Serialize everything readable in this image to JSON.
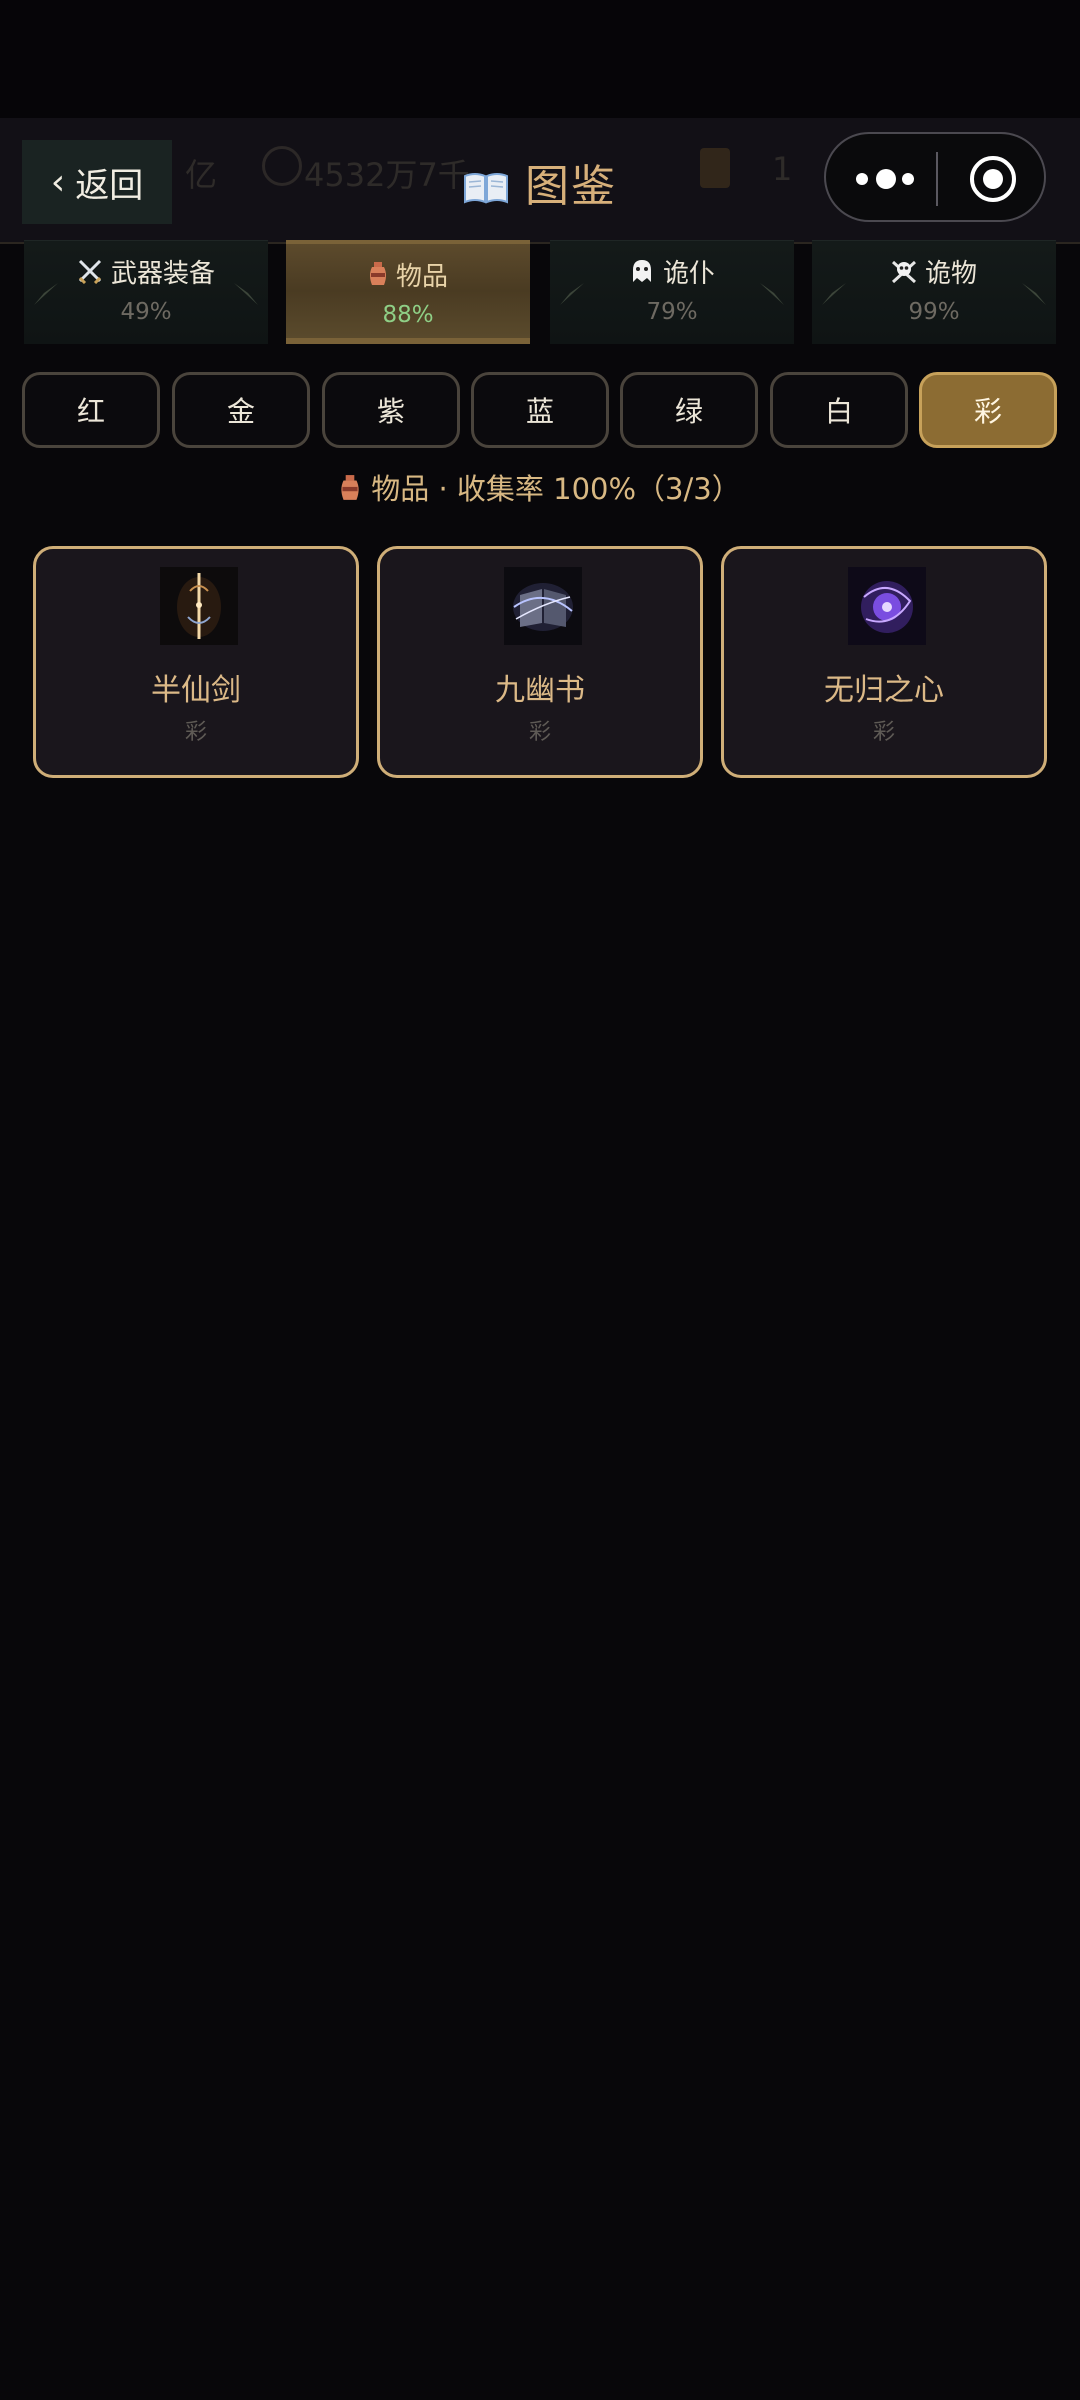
{
  "header": {
    "back_label": "返回",
    "title": "图鉴",
    "ghost_left": "亿",
    "ghost_gold": "4532万7千",
    "ghost_right": "1"
  },
  "categories": [
    {
      "label": "武器装备",
      "percent": "49%",
      "icon": "crossed-swords-icon"
    },
    {
      "label": "物品",
      "percent": "88%",
      "icon": "vase-icon",
      "active": true
    },
    {
      "label": "诡仆",
      "percent": "79%",
      "icon": "ghost-icon"
    },
    {
      "label": "诡物",
      "percent": "99%",
      "icon": "skull-crossbones-icon"
    }
  ],
  "grades": [
    "红",
    "金",
    "紫",
    "蓝",
    "绿",
    "白",
    "彩"
  ],
  "active_grade": "彩",
  "summary": {
    "category": "物品",
    "separator": "·",
    "text": "收集率 100%（3/3）"
  },
  "items": [
    {
      "name": "半仙剑",
      "grade": "彩",
      "icon": "sword-icon"
    },
    {
      "name": "九幽书",
      "grade": "彩",
      "icon": "book-icon"
    },
    {
      "name": "无归之心",
      "grade": "彩",
      "icon": "heart-orb-icon"
    }
  ],
  "colors": {
    "background": "#08070a",
    "accent_gold": "#cfae78",
    "active_filter": "#8c6c33",
    "percent_active": "#8fcf86"
  }
}
